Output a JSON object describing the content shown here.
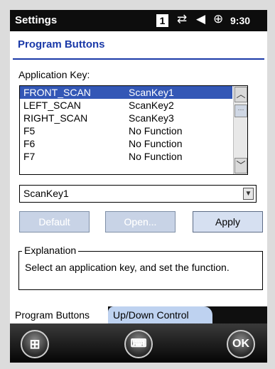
{
  "status_bar": {
    "title": "Settings",
    "badge": "1",
    "connectivity_glyph": "⇄",
    "volume_glyph": "◀",
    "battery_glyph": "⊕",
    "time": "9:30"
  },
  "header": {
    "title": "Program Buttons"
  },
  "application_key": {
    "label": "Application Key:",
    "rows": [
      {
        "key": "FRONT_SCAN",
        "value": "ScanKey1",
        "selected": true
      },
      {
        "key": "LEFT_SCAN",
        "value": "ScanKey2"
      },
      {
        "key": "RIGHT_SCAN",
        "value": "ScanKey3"
      },
      {
        "key": "F5",
        "value": "No Function"
      },
      {
        "key": "F6",
        "value": "No Function"
      },
      {
        "key": "F7",
        "value": "No Function"
      }
    ],
    "scroll_up_glyph": "︿",
    "scroll_down_glyph": "﹀",
    "scroll_thumb_glyph": "⋯"
  },
  "function_select": {
    "value": "ScanKey1",
    "arrow_glyph": "▼"
  },
  "buttons": {
    "default": "Default",
    "open": "Open...",
    "apply": "Apply"
  },
  "explanation": {
    "legend": "Explanation",
    "text": "Select an application key, and set the function."
  },
  "tabs": [
    {
      "label": "Program Buttons",
      "active": true
    },
    {
      "label": "Up/Down Control",
      "active": false
    }
  ],
  "bottom_bar": {
    "start_glyph": "⊞",
    "keyboard_glyph": "⌨",
    "ok_label": "OK"
  },
  "colors": {
    "accent_blue": "#1a39a8",
    "selection": "#3357b6",
    "tab_inactive": "#bed2f0"
  }
}
